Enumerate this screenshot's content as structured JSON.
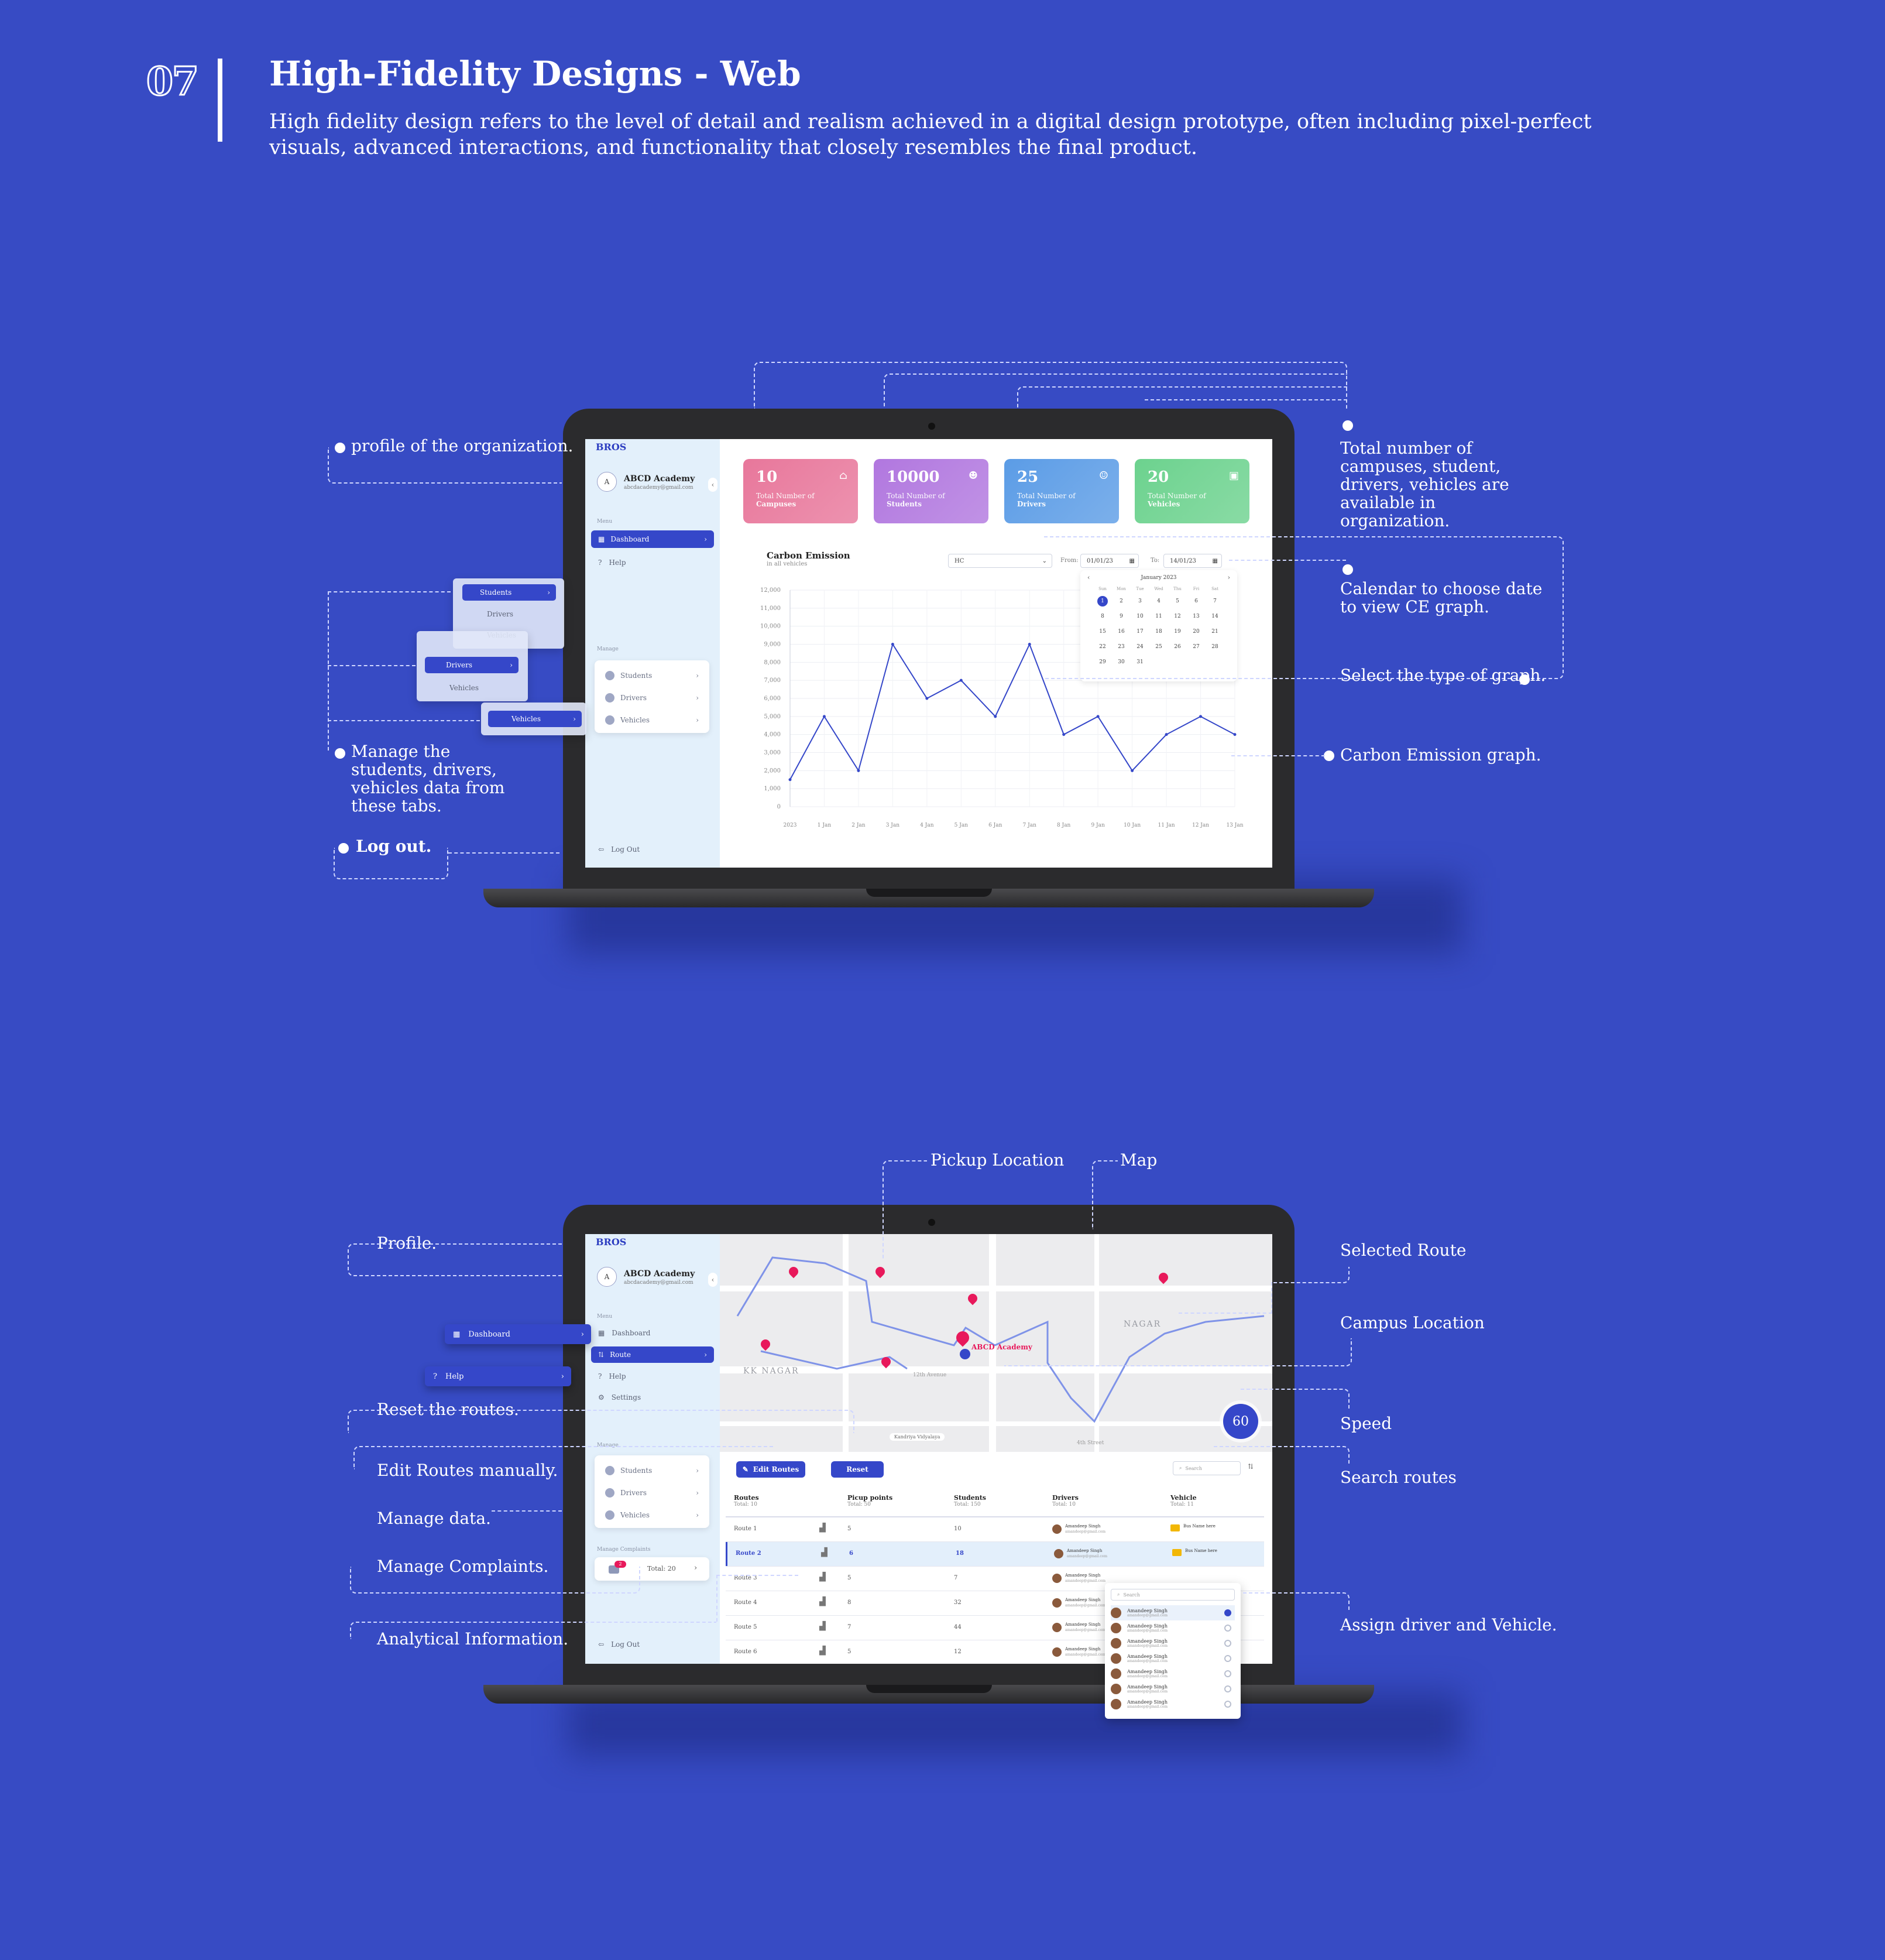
{
  "header": {
    "step": "07",
    "title": "High-Fidelity Designs - Web",
    "description": "High fidelity design refers to the level of detail and realism achieved in a digital design prototype, often including pixel-perfect visuals, advanced interactions, and functionality that closely resembles the final product."
  },
  "annotations_top": {
    "profile": "profile of the organization.",
    "manage": "Manage the students, drivers, vehicles data from these tabs.",
    "logout": "Log out.",
    "totals": "Total number of campuses, student, drivers, vehicles are available in organization.",
    "calendar": "Calendar to choose date to view CE graph.",
    "graph_type": "Select the type of graph.",
    "ce_graph": "Carbon Emission graph."
  },
  "annotations_bottom": {
    "pickup": "Pickup Location",
    "map": "Map",
    "profile": "Profile.",
    "selected_route": "Selected Route",
    "campus": "Campus Location",
    "speed": "Speed",
    "search": "Search routes",
    "reset": "Reset the routes.",
    "edit": "Edit Routes manually.",
    "manage_data": "Manage data.",
    "complaints": "Manage Complaints.",
    "analytics": "Analytical Information.",
    "assign": "Assign driver and Vehicle."
  },
  "app": {
    "brand": "BROS",
    "org_name": "ABCD Academy",
    "org_email": "abcdacademy@gmail.com",
    "avatar_letter": "A",
    "menu_label": "Menu",
    "manage_label": "Manage",
    "logout": "Log Out",
    "help": "Help",
    "dashboard": "Dashboard",
    "route": "Route",
    "settings": "Settings",
    "students": "Students",
    "drivers": "Drivers",
    "vehicles": "Vehicles",
    "manage_complaints": "Manage Complaints",
    "complaints_total": "Total: 20",
    "complaints_badge": "2"
  },
  "stats": [
    {
      "value": "10",
      "l1": "Total Number of",
      "l2": "Campuses",
      "color": "#e8779b"
    },
    {
      "value": "10000",
      "l1": "Total Number of",
      "l2": "Students",
      "color": "#b177df"
    },
    {
      "value": "25",
      "l1": "Total Number of",
      "l2": "Drivers",
      "color": "#5b9ce6"
    },
    {
      "value": "20",
      "l1": "Total Number of",
      "l2": "Vehicles",
      "color": "#6cd28e"
    }
  ],
  "chart_header": {
    "title": "Carbon Emission",
    "subtitle": "in all vehicles",
    "select": "HC",
    "from_label": "From:",
    "from_value": "01/01/23",
    "to_label": "To:",
    "to_value": "14/01/23",
    "calendar_month": "January 2023"
  },
  "calendar": {
    "weekdays": [
      "Sun",
      "Mon",
      "Tue",
      "Wed",
      "Thu",
      "Fri",
      "Sat"
    ],
    "days": [
      "1",
      "2",
      "3",
      "4",
      "5",
      "6",
      "7",
      "8",
      "9",
      "10",
      "11",
      "12",
      "13",
      "14",
      "15",
      "16",
      "17",
      "18",
      "19",
      "20",
      "21",
      "22",
      "23",
      "24",
      "25",
      "26",
      "27",
      "28",
      "29",
      "30",
      "31"
    ],
    "selected": "1"
  },
  "chart_data": {
    "type": "line",
    "title": "Carbon Emission",
    "subtitle": "in all vehicles",
    "x": [
      "2023",
      "1 Jan",
      "2 Jan",
      "3 Jan",
      "4 Jan",
      "5 Jan",
      "6 Jan",
      "7 Jan",
      "8 Jan",
      "9 Jan",
      "10 Jan",
      "11 Jan",
      "12 Jan",
      "13 Jan"
    ],
    "y_ticks": [
      "12,000",
      "11,000",
      "10,000",
      "9,000",
      "8,000",
      "7,000",
      "6,000",
      "5,000",
      "4,000",
      "3,000",
      "2,000",
      "1,000",
      "0"
    ],
    "series": [
      {
        "values": [
          1500,
          5000,
          2000,
          9000,
          6000,
          7000,
          5000,
          9000,
          4000,
          5000,
          2000,
          4000,
          5000,
          4000
        ]
      }
    ],
    "ylim": [
      0,
      12000
    ],
    "grid": true,
    "color": "#3547c9"
  },
  "map": {
    "campus_label": "ABCD Academy",
    "area1": "KK NAGAR",
    "area2": "NAGAR",
    "street1": "12th Avenue",
    "street2": "4th Street",
    "speed": "60",
    "pill": "Kandriya Vidyalaya"
  },
  "route_controls": {
    "edit": "Edit Routes",
    "reset": "Reset",
    "search_placeholder": "Search"
  },
  "table": {
    "columns": [
      {
        "name": "Routes",
        "sub": "Total: 10"
      },
      {
        "name": "Picup points",
        "sub": "Total: 50"
      },
      {
        "name": "Students",
        "sub": "Total: 150"
      },
      {
        "name": "Drivers",
        "sub": "Total: 10"
      },
      {
        "name": "Vehicle",
        "sub": "Total: 11"
      }
    ],
    "rows": [
      {
        "route": "Route 1",
        "points": "5",
        "students": "10",
        "driver": "Amandeep Singh",
        "vehicle": "Bus Name here"
      },
      {
        "route": "Route 2",
        "points": "6",
        "students": "18",
        "driver": "Amandeep Singh",
        "vehicle": "Bus Name here"
      },
      {
        "route": "Route 3",
        "points": "5",
        "students": "7",
        "driver": "Amandeep Singh",
        "vehicle": ""
      },
      {
        "route": "Route 4",
        "points": "8",
        "students": "32",
        "driver": "Amandeep Singh",
        "vehicle": ""
      },
      {
        "route": "Route 5",
        "points": "7",
        "students": "44",
        "driver": "Amandeep Singh",
        "vehicle": ""
      },
      {
        "route": "Route 6",
        "points": "5",
        "students": "12",
        "driver": "Amandeep Singh",
        "vehicle": ""
      }
    ]
  },
  "popup": {
    "search": "Search",
    "items": [
      "Amandeep Singh",
      "Amandeep Singh",
      "Amandeep Singh",
      "Amandeep Singh",
      "Amandeep Singh",
      "Amandeep Singh",
      "Amandeep Singh"
    ],
    "email": "amandeep@gmail.com"
  }
}
